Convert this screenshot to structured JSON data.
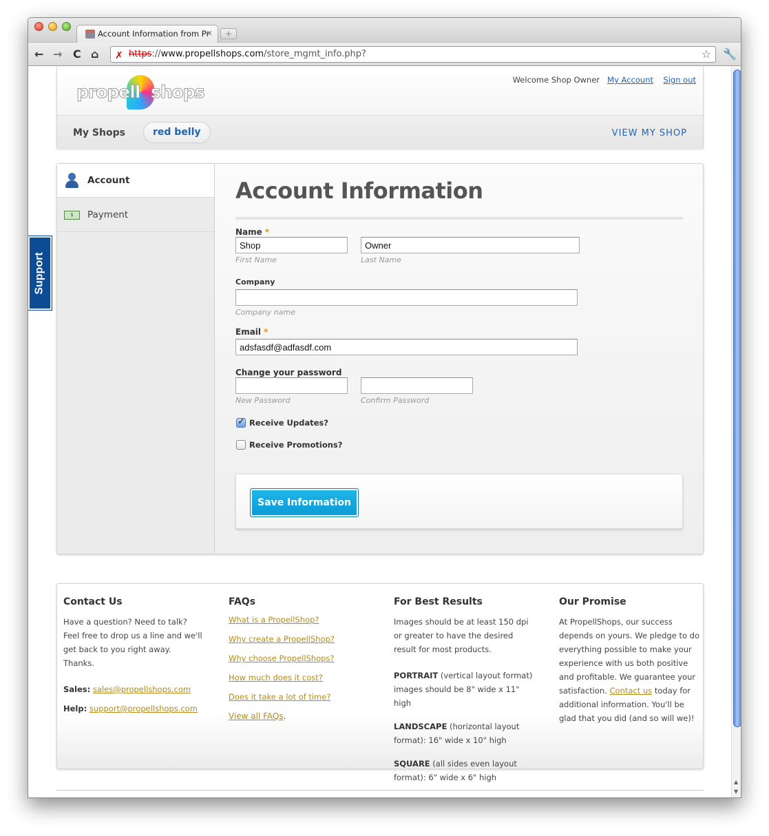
{
  "browser": {
    "tab_title": "Account Information from Pr",
    "tab_close": "✕",
    "new_tab": "+",
    "url_scheme": "https",
    "url_sep": "://",
    "url_host": "www.propellshops.com",
    "url_path": "/store_mgmt_info.php?",
    "back": "←",
    "forward": "→",
    "reload": "C",
    "home": "⌂",
    "star": "☆",
    "wrench": "🔧"
  },
  "header": {
    "logo_left": "propell",
    "logo_right": "shops",
    "welcome": "Welcome Shop Owner",
    "my_account": "My Account",
    "sign_out": "Sign out",
    "my_shops": "My Shops",
    "shop_name": "red belly",
    "view_shop": "VIEW MY SHOP"
  },
  "support": {
    "label": "Support"
  },
  "sidebar": {
    "items": [
      {
        "label": "Account",
        "icon": "user-icon",
        "active": true
      },
      {
        "label": "Payment",
        "icon": "money-icon",
        "active": false
      }
    ],
    "money_glyph": "$"
  },
  "form": {
    "title": "Account Information",
    "required_mark": "*",
    "name_label": "Name",
    "first_name_value": "Shop",
    "first_name_hint": "First Name",
    "last_name_value": "Owner",
    "last_name_hint": "Last Name",
    "company_label": "Company",
    "company_value": "",
    "company_hint": "Company name",
    "email_label": "Email",
    "email_value": "adsfasdf@adfasdf.com",
    "password_label": "Change your password",
    "new_password_hint": "New Password",
    "confirm_password_hint": "Confirm Password",
    "receive_updates": "Receive Updates?",
    "receive_updates_checked": true,
    "receive_promotions": "Receive Promotions?",
    "receive_promotions_checked": false,
    "save_button": "Save Information"
  },
  "footer": {
    "contact": {
      "title": "Contact Us",
      "text": "Have a question? Need to talk? Feel free to drop us a line and we'll get back to you right away. Thanks.",
      "sales_label": "Sales:",
      "sales_email": "sales@propellshops.com",
      "help_label": "Help:",
      "help_email": "support@propellshops.com"
    },
    "faqs": {
      "title": "FAQs",
      "links": [
        "What is a PropellShop?",
        "Why create a PropellShop?",
        "Why choose PropellShops?",
        "How much does it cost?",
        "Does it take a lot of time?"
      ],
      "view_all": "View all FAQs",
      "view_all_suffix": "."
    },
    "best_results": {
      "title": "For Best Results",
      "intro": "Images should be at least 150 dpi or greater to have the desired result for most products.",
      "portrait_label": "PORTRAIT",
      "portrait_text": " (vertical layout format) images should be 8\" wide x 11\" high",
      "landscape_label": "LANDSCAPE",
      "landscape_text": " (horizontal layout format): 16\" wide x 10\" high",
      "square_label": "SQUARE",
      "square_text": " (all sides even layout format): 6\" wide x 6\" high"
    },
    "promise": {
      "title": "Our Promise",
      "text_before": "At PropellShops, our success depends on yours. We pledge to do everything possible to make your experience with us both positive and profitable. We guarantee your satisfaction.",
      "contact_link": "Contact us",
      "text_after": " today for additional information. You'll be glad that you did (and so will we)!"
    }
  }
}
